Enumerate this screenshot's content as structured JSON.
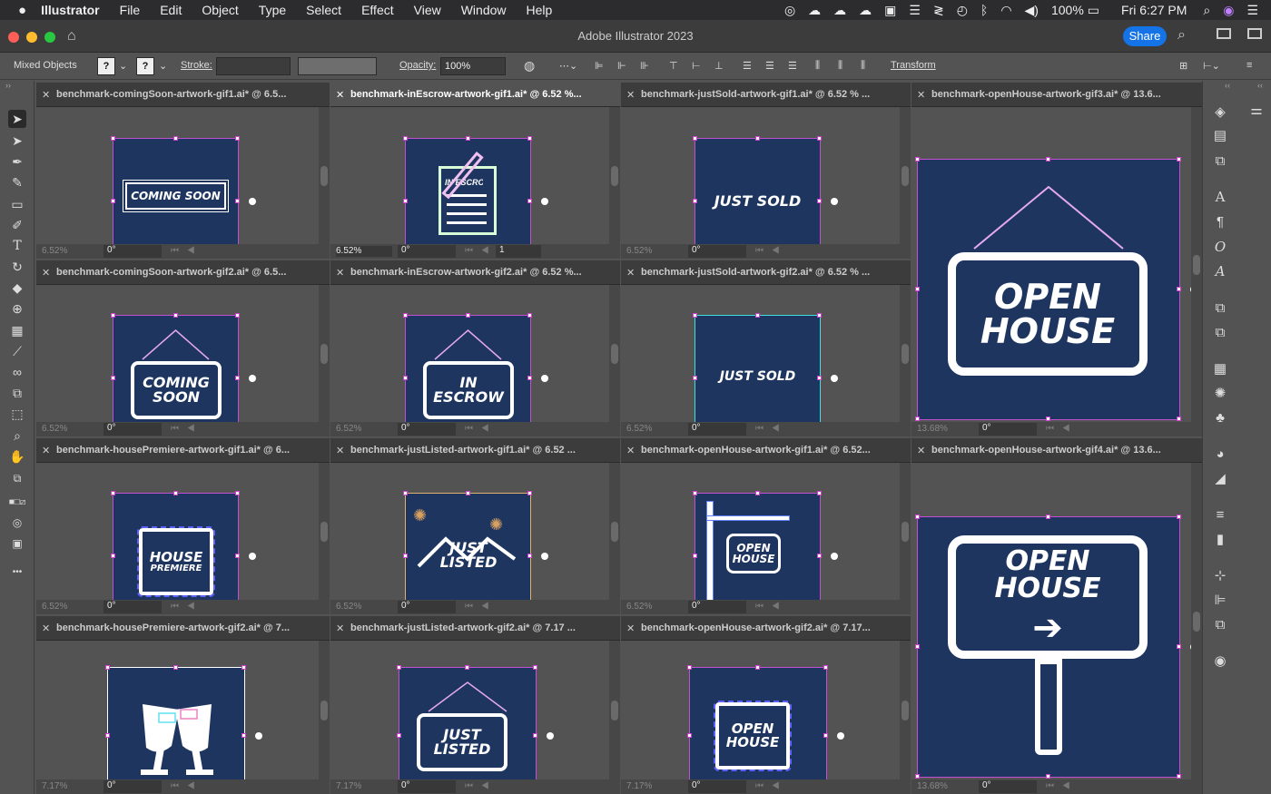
{
  "menubar": {
    "apple": "",
    "app": "Illustrator",
    "items": [
      "File",
      "Edit",
      "Object",
      "Type",
      "Select",
      "Effect",
      "View",
      "Window",
      "Help"
    ],
    "battery": "100%",
    "clock": "Fri 6:27 PM"
  },
  "window": {
    "title": "Adobe Illustrator 2023",
    "share": "Share"
  },
  "control": {
    "selection": "Mixed Objects",
    "q1": "?",
    "q2": "?",
    "stroke_label": "Stroke:",
    "opacity_label": "Opacity:",
    "opacity": "100%",
    "transform": "Transform"
  },
  "docs": [
    {
      "title": "benchmark-comingSoon-artwork-gif1.ai* @ 6.5...",
      "zoom": "6.52%",
      "rotation": "0°",
      "art": "COMING SOON"
    },
    {
      "title": "benchmark-inEscrow-artwork-gif1.ai* @ 6.52 %...",
      "zoom": "6.52%",
      "rotation": "0°",
      "page": "1",
      "art": "IN ESCROW"
    },
    {
      "title": "benchmark-justSold-artwork-gif1.ai* @ 6.52 % ...",
      "zoom": "6.52%",
      "rotation": "0°",
      "art": "JUST SOLD"
    },
    {
      "title": "benchmark-openHouse-artwork-gif3.ai* @ 13.6...",
      "zoom": "13.68%",
      "rotation": "0°",
      "art1": "OPEN",
      "art2": "HOUSE"
    },
    {
      "title": "benchmark-comingSoon-artwork-gif2.ai* @ 6.5...",
      "zoom": "6.52%",
      "rotation": "0°",
      "art1": "COMING",
      "art2": "SOON"
    },
    {
      "title": "benchmark-inEscrow-artwork-gif2.ai* @ 6.52 %...",
      "zoom": "6.52%",
      "rotation": "0°",
      "art1": "IN",
      "art2": "ESCROW"
    },
    {
      "title": "benchmark-justSold-artwork-gif2.ai* @ 6.52 % ...",
      "zoom": "6.52%",
      "rotation": "0°",
      "art": "JUST SOLD"
    },
    {
      "title": "benchmark-housePremiere-artwork-gif1.ai* @ 6...",
      "zoom": "6.52%",
      "rotation": "0°",
      "art1": "HOUSE",
      "art2": "PREMIERE"
    },
    {
      "title": "benchmark-justListed-artwork-gif1.ai* @ 6.52 ...",
      "zoom": "6.52%",
      "rotation": "0°",
      "art1": "JUST",
      "art2": "LISTED"
    },
    {
      "title": "benchmark-openHouse-artwork-gif1.ai* @ 6.52...",
      "zoom": "6.52%",
      "rotation": "0°",
      "art1": "OPEN",
      "art2": "HOUSE"
    },
    {
      "title": "benchmark-openHouse-artwork-gif4.ai* @ 13.6...",
      "zoom": "13.68%",
      "rotation": "0°",
      "art": "OPEN HOUSE",
      "arrow": "➔"
    },
    {
      "title": "benchmark-housePremiere-artwork-gif2.ai* @ 7...",
      "zoom": "7.17%",
      "rotation": "0°"
    },
    {
      "title": "benchmark-justListed-artwork-gif2.ai* @ 7.17 ...",
      "zoom": "7.17%",
      "rotation": "0°",
      "art1": "JUST",
      "art2": "LISTED"
    },
    {
      "title": "benchmark-openHouse-artwork-gif2.ai* @ 7.17...",
      "zoom": "7.17%",
      "rotation": "0°",
      "art1": "OPEN",
      "art2": "HOUSE"
    }
  ],
  "tools_left": [
    "selection-tool",
    "direct-selection-tool",
    "pen-tool",
    "curvature-tool",
    "rectangle-tool",
    "paintbrush-tool",
    "type-tool",
    "rotate-tool",
    "eraser-tool",
    "shape-builder-tool",
    "gradient-tool",
    "eyedropper-tool",
    "blend-tool",
    "artboard-tool",
    "slice-tool",
    "zoom-tool",
    "hand-tool",
    "fill-stroke",
    "swap-colors",
    "color-none",
    "draw-mode",
    "screen-mode",
    "more-tools"
  ],
  "tools_glyphs": {
    "type": "T",
    "more": "•••"
  },
  "panels_right": [
    "properties-icon",
    "layers-icon",
    "libraries-icon",
    "artboards-icon",
    "character-icon",
    "paragraph-icon",
    "opentype-icon",
    "glyphs-icon",
    "char-styles-icon",
    "para-styles-icon",
    "swatches-icon",
    "brushes-icon",
    "symbols-icon",
    "color-icon",
    "color-guide-icon",
    "stroke-icon",
    "gradient-icon",
    "transform-icon",
    "align-icon",
    "pathfinder-icon",
    "appearance-icon"
  ],
  "panel_glyphs": {
    "character": "A",
    "paragraph": "¶",
    "opentype": "O",
    "glyphs": "A"
  }
}
